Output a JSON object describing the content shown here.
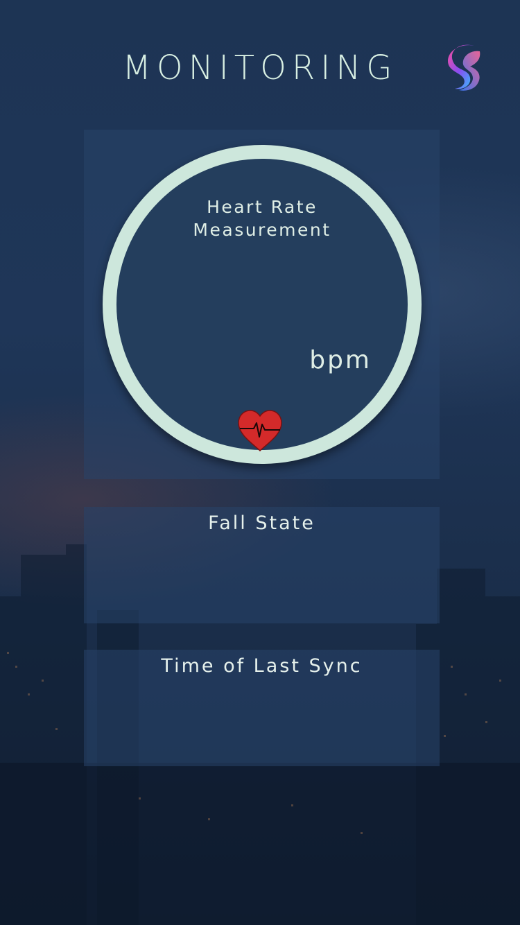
{
  "header": {
    "title": "MONITORING",
    "logo_icon": "app-logo-s-icon"
  },
  "heart_rate": {
    "label_line1": "Heart Rate",
    "label_line2": "Measurement",
    "unit": "bpm",
    "icon": "heart-pulse-icon"
  },
  "fall_state": {
    "title": "Fall State"
  },
  "last_sync": {
    "title": "Time of Last Sync"
  },
  "colors": {
    "ring": "#cde7dc",
    "panel": "#284469",
    "heart": "#d42a2a",
    "text": "#dfeee6"
  }
}
